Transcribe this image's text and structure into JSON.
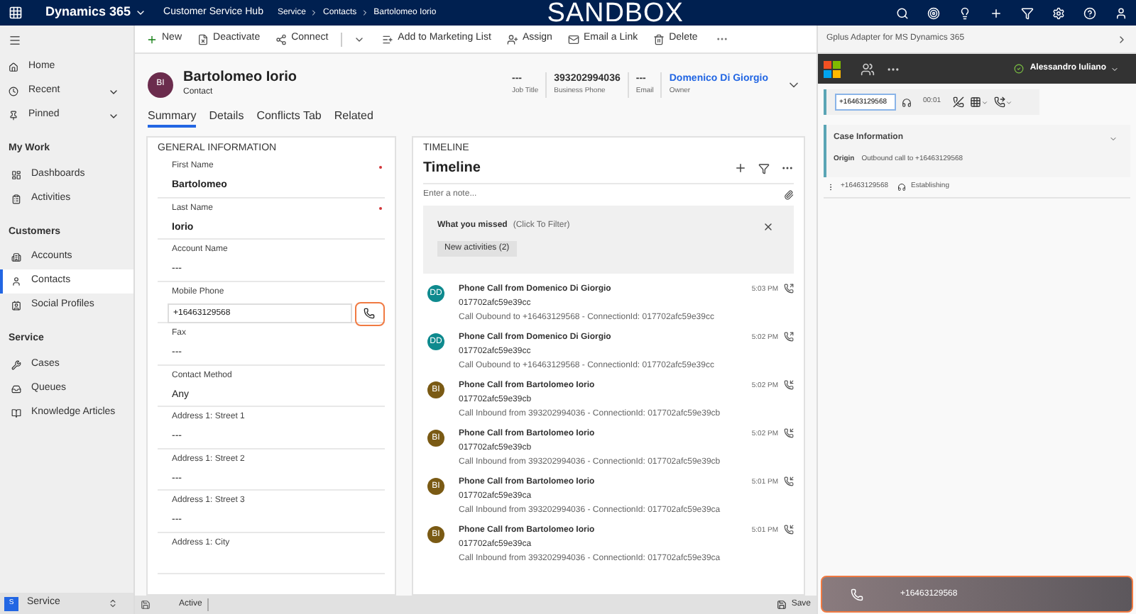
{
  "top_bar": {
    "app_name": "Dynamics 365",
    "hub": "Customer Service Hub",
    "breadcrumb": [
      "Service",
      "Contacts",
      "Bartolomeo Iorio"
    ],
    "environment": "SANDBOX"
  },
  "sidebar": {
    "items": [
      {
        "label": "Home",
        "expandable": false
      },
      {
        "label": "Recent",
        "expandable": true
      },
      {
        "label": "Pinned",
        "expandable": true
      }
    ],
    "groups": [
      {
        "title": "My Work",
        "items": [
          {
            "label": "Dashboards",
            "selected": false
          },
          {
            "label": "Activities",
            "selected": false
          }
        ]
      },
      {
        "title": "Customers",
        "items": [
          {
            "label": "Accounts",
            "selected": false
          },
          {
            "label": "Contacts",
            "selected": true
          },
          {
            "label": "Social Profiles",
            "selected": false
          }
        ]
      },
      {
        "title": "Service",
        "items": [
          {
            "label": "Cases",
            "selected": false
          },
          {
            "label": "Queues",
            "selected": false
          },
          {
            "label": "Knowledge Articles",
            "selected": false
          }
        ]
      }
    ],
    "area": {
      "badge": "S",
      "label": "Service"
    }
  },
  "command_bar": [
    {
      "label": "New",
      "has_dropdown": false
    },
    {
      "label": "Deactivate",
      "has_dropdown": false
    },
    {
      "label": "Connect",
      "has_dropdown": true
    },
    {
      "label": "Add to Marketing List",
      "has_dropdown": false
    },
    {
      "label": "Assign",
      "has_dropdown": false
    },
    {
      "label": "Email a Link",
      "has_dropdown": false
    },
    {
      "label": "Delete",
      "has_dropdown": false
    }
  ],
  "record": {
    "initials": "BI",
    "name": "Bartolomeo Iorio",
    "type": "Contact",
    "header_fields": [
      {
        "value": "---",
        "label": "Job Title",
        "link": false
      },
      {
        "value": "393202994036",
        "label": "Business Phone",
        "link": false
      },
      {
        "value": "---",
        "label": "Email",
        "link": false
      },
      {
        "value": "Domenico Di Giorgio",
        "label": "Owner",
        "link": true
      }
    ]
  },
  "tabs": [
    {
      "label": "Summary",
      "selected": true
    },
    {
      "label": "Details",
      "selected": false
    },
    {
      "label": "Conflicts Tab",
      "selected": false
    },
    {
      "label": "Related",
      "selected": false
    }
  ],
  "general_information": {
    "title": "GENERAL INFORMATION",
    "fields": [
      {
        "kind": "text",
        "label": "First Name",
        "value": "Bartolomeo",
        "required": true
      },
      {
        "kind": "text",
        "label": "Last Name",
        "value": "Iorio",
        "required": true
      },
      {
        "kind": "text",
        "label": "Account Name",
        "value": "---",
        "required": false
      },
      {
        "kind": "phone",
        "label": "Mobile Phone",
        "value": "+16463129568",
        "required": false
      },
      {
        "kind": "text",
        "label": "Fax",
        "value": "---",
        "required": false
      },
      {
        "kind": "text",
        "label": "Contact Method",
        "value": "Any",
        "required": false
      },
      {
        "kind": "text",
        "label": "Address 1: Street 1",
        "value": "---",
        "required": false
      },
      {
        "kind": "text",
        "label": "Address 1: Street 2",
        "value": "---",
        "required": false
      },
      {
        "kind": "text",
        "label": "Address 1: Street 3",
        "value": "---",
        "required": false
      },
      {
        "kind": "text",
        "label": "Address 1: City",
        "required": false
      }
    ]
  },
  "timeline": {
    "section_title": "TIMELINE",
    "title": "Timeline",
    "note_placeholder": "Enter a note...",
    "missed": {
      "title": "What you missed",
      "hint": "(Click To Filter)",
      "button": "New activities (2)"
    },
    "items": [
      {
        "initials": "DD",
        "color": "#0e8a8e",
        "title": "Phone Call from Domenico Di Giorgio",
        "subtitle": "017702afc59e39cc",
        "description": "Call Oubound to +16463129568 - ConnectionId: 017702afc59e39cc",
        "time": "5:03 PM",
        "kind": "outbound"
      },
      {
        "initials": "DD",
        "color": "#0e8a8e",
        "title": "Phone Call from Domenico Di Giorgio",
        "subtitle": "017702afc59e39cc",
        "description": "Call Oubound to +16463129568 - ConnectionId: 017702afc59e39cc",
        "time": "5:02 PM",
        "kind": "outbound"
      },
      {
        "initials": "BI",
        "color": "#7a5a14",
        "title": "Phone Call from Bartolomeo Iorio",
        "subtitle": "017702afc59e39cb",
        "description": "Call Inbound from 393202994036 - ConnectionId: 017702afc59e39cb",
        "time": "5:02 PM",
        "kind": "inbound"
      },
      {
        "initials": "BI",
        "color": "#7a5a14",
        "title": "Phone Call from Bartolomeo Iorio",
        "subtitle": "017702afc59e39cb",
        "description": "Call Inbound from 393202994036 - ConnectionId: 017702afc59e39cb",
        "time": "5:02 PM",
        "kind": "inbound"
      },
      {
        "initials": "BI",
        "color": "#7a5a14",
        "title": "Phone Call from Bartolomeo Iorio",
        "subtitle": "017702afc59e39ca",
        "description": "Call Inbound from 393202994036 - ConnectionId: 017702afc59e39ca",
        "time": "5:01 PM",
        "kind": "inbound"
      },
      {
        "initials": "BI",
        "color": "#7a5a14",
        "title": "Phone Call from Bartolomeo Iorio",
        "subtitle": "017702afc59e39ca",
        "description": "Call Inbound from 393202994036 - ConnectionId: 017702afc59e39ca",
        "time": "5:01 PM",
        "kind": "inbound"
      }
    ]
  },
  "status_bar": {
    "status": "Active",
    "save": "Save"
  },
  "adapter": {
    "title": "Gplus Adapter for MS Dynamics 365",
    "agent": {
      "name": "Alessandro Iuliano",
      "ready": true
    },
    "call_controls": {
      "number": "+16463129568",
      "timer": "00:01"
    },
    "case_info": {
      "title": "Case Information",
      "expanded": true,
      "origin_label": "Origin",
      "origin_value": "Outbound call to +16463129568"
    },
    "call": {
      "number": "+16463129568",
      "state": "Establishing"
    },
    "call_banner": {
      "number": "+16463129568"
    }
  }
}
